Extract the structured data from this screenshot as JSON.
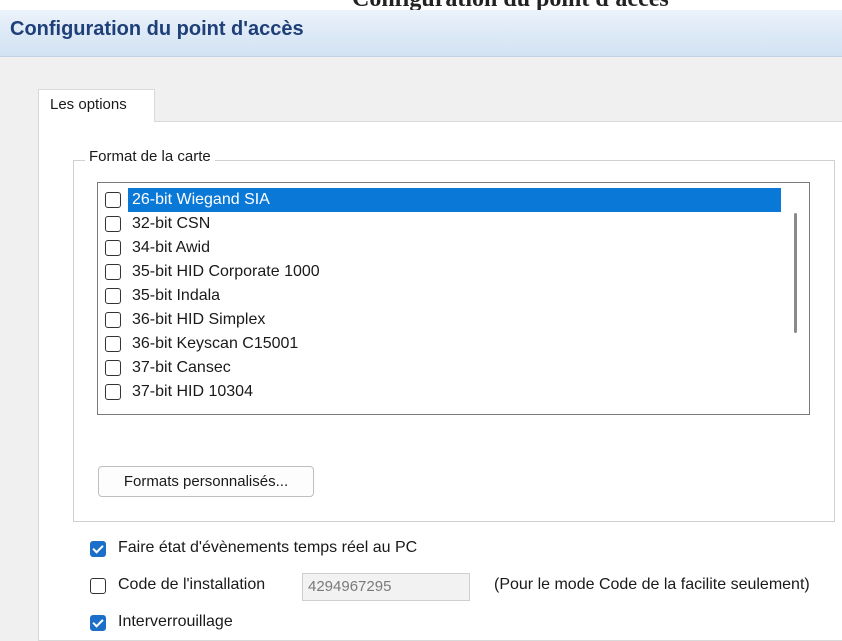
{
  "window": {
    "title": "Configuration du point d'accès",
    "cropped_heading": "Configuration du point d'accès"
  },
  "tabs": [
    {
      "label": "Les options",
      "active": true
    }
  ],
  "card_format": {
    "group_label": "Format de la carte",
    "items": [
      {
        "label": "26-bit Wiegand SIA",
        "checked": false,
        "selected": true
      },
      {
        "label": "32-bit CSN",
        "checked": false,
        "selected": false
      },
      {
        "label": "34-bit Awid",
        "checked": false,
        "selected": false
      },
      {
        "label": "35-bit HID Corporate 1000",
        "checked": false,
        "selected": false
      },
      {
        "label": "35-bit Indala",
        "checked": false,
        "selected": false
      },
      {
        "label": "36-bit HID Simplex",
        "checked": false,
        "selected": false
      },
      {
        "label": "36-bit Keyscan C15001",
        "checked": false,
        "selected": false
      },
      {
        "label": "37-bit Cansec",
        "checked": false,
        "selected": false
      },
      {
        "label": "37-bit HID 10304",
        "checked": false,
        "selected": false
      }
    ],
    "custom_formats_button": "Formats personnalisés..."
  },
  "options": {
    "report_events": {
      "label": "Faire état d'évènements temps réel au PC",
      "checked": true
    },
    "facility_code": {
      "label": "Code de l'installation",
      "checked": false,
      "value": "4294967295",
      "note": "(Pour le mode Code de la facilite seulement)"
    },
    "interlock": {
      "label": "Interverrouillage",
      "checked": true
    }
  },
  "colors": {
    "selection": "#0a78d7",
    "checkbox_checked": "#1c6fc9",
    "title_text": "#1e3f78"
  }
}
